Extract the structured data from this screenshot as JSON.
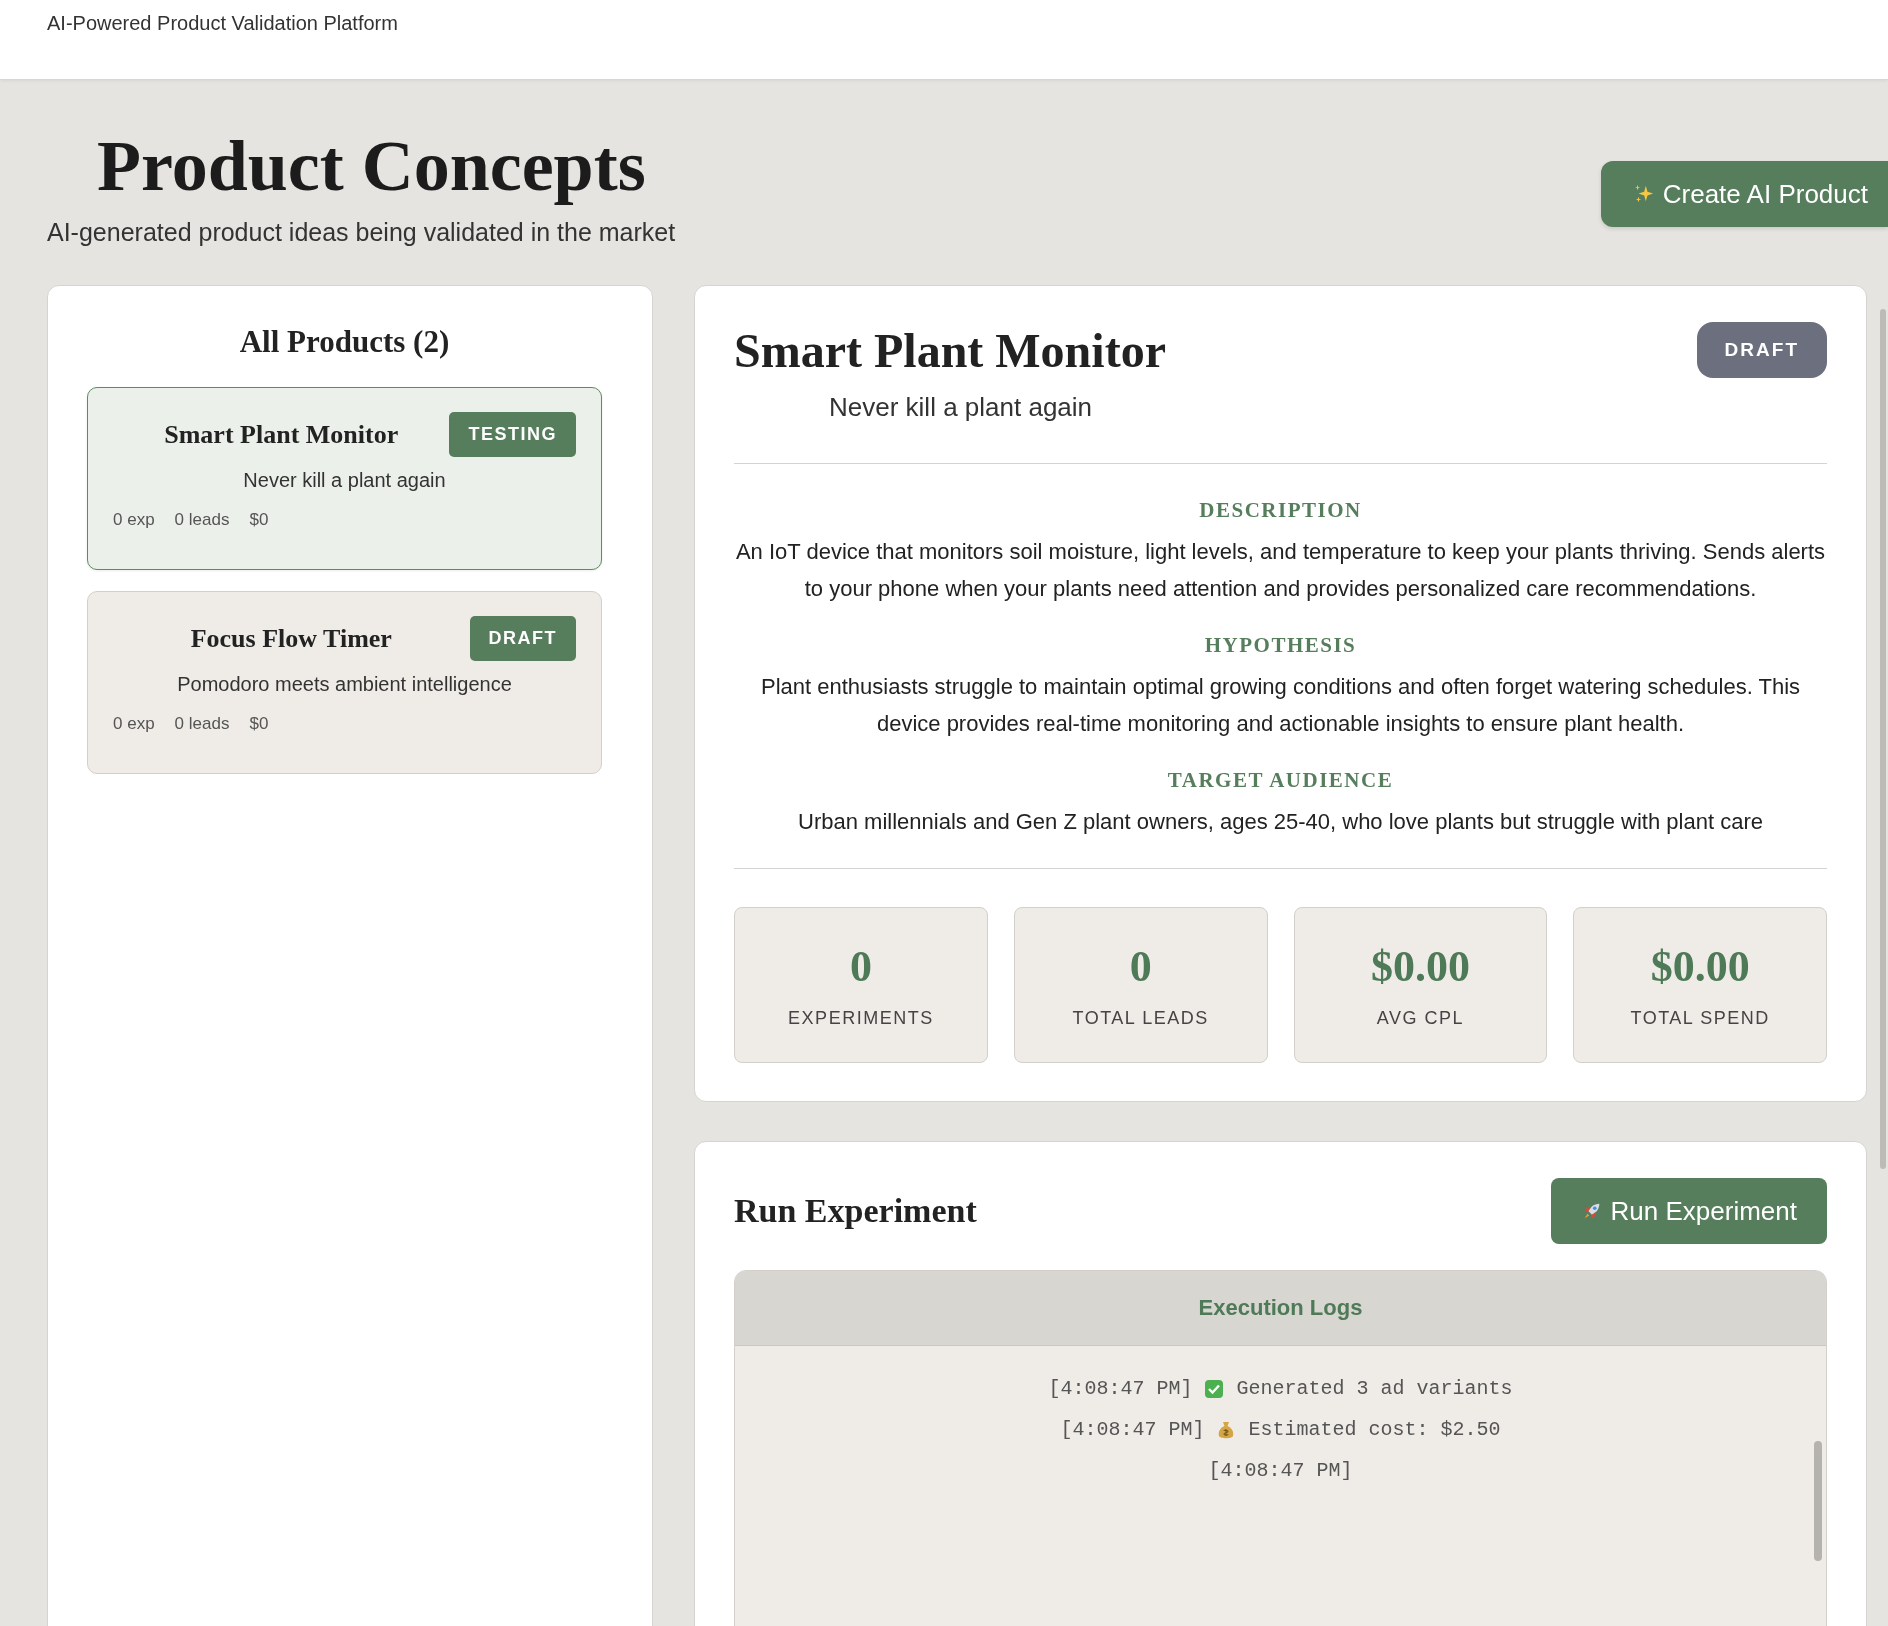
{
  "header": {
    "title": "AI-Powered Product Validation Platform"
  },
  "page": {
    "title": "Product Concepts",
    "subtitle": "AI-generated product ideas being validated in the market",
    "create_button": "Create AI Product"
  },
  "products_panel": {
    "title": "All Products (2)",
    "products": [
      {
        "name": "Smart Plant Monitor",
        "status": "TESTING",
        "tagline": "Never kill a plant again",
        "stats": [
          "0 exp",
          "0 leads",
          "$0"
        ],
        "selected": true
      },
      {
        "name": "Focus Flow Timer",
        "status": "DRAFT",
        "tagline": "Pomodoro meets ambient intelligence",
        "stats": [
          "0 exp",
          "0 leads",
          "$0"
        ],
        "selected": false
      }
    ]
  },
  "detail": {
    "name": "Smart Plant Monitor",
    "status": "DRAFT",
    "tagline": "Never kill a plant again",
    "sections": [
      {
        "heading": "DESCRIPTION",
        "text": "An IoT device that monitors soil moisture, light levels, and temperature to keep your plants thriving. Sends alerts to your phone when your plants need attention and provides personalized care recommendations."
      },
      {
        "heading": "HYPOTHESIS",
        "text": "Plant enthusiasts struggle to maintain optimal growing conditions and often forget watering schedules. This device provides real-time monitoring and actionable insights to ensure plant health."
      },
      {
        "heading": "TARGET AUDIENCE",
        "text": "Urban millennials and Gen Z plant owners, ages 25-40, who love plants but struggle with plant care"
      }
    ],
    "stats": [
      {
        "value": "0",
        "label": "EXPERIMENTS"
      },
      {
        "value": "0",
        "label": "TOTAL LEADS"
      },
      {
        "value": "$0.00",
        "label": "AVG CPL"
      },
      {
        "value": "$0.00",
        "label": "TOTAL SPEND"
      }
    ]
  },
  "experiment": {
    "title": "Run Experiment",
    "button": "Run Experiment",
    "logs_title": "Execution Logs",
    "logs": [
      {
        "time": "[4:08:47 PM]",
        "kind": "check",
        "text": "Generated 3 ad variants"
      },
      {
        "time": "[4:08:47 PM]",
        "kind": "money",
        "text": "Estimated cost: $2.50"
      },
      {
        "time": "[4:08:47 PM]",
        "kind": "plain"
      }
    ]
  }
}
